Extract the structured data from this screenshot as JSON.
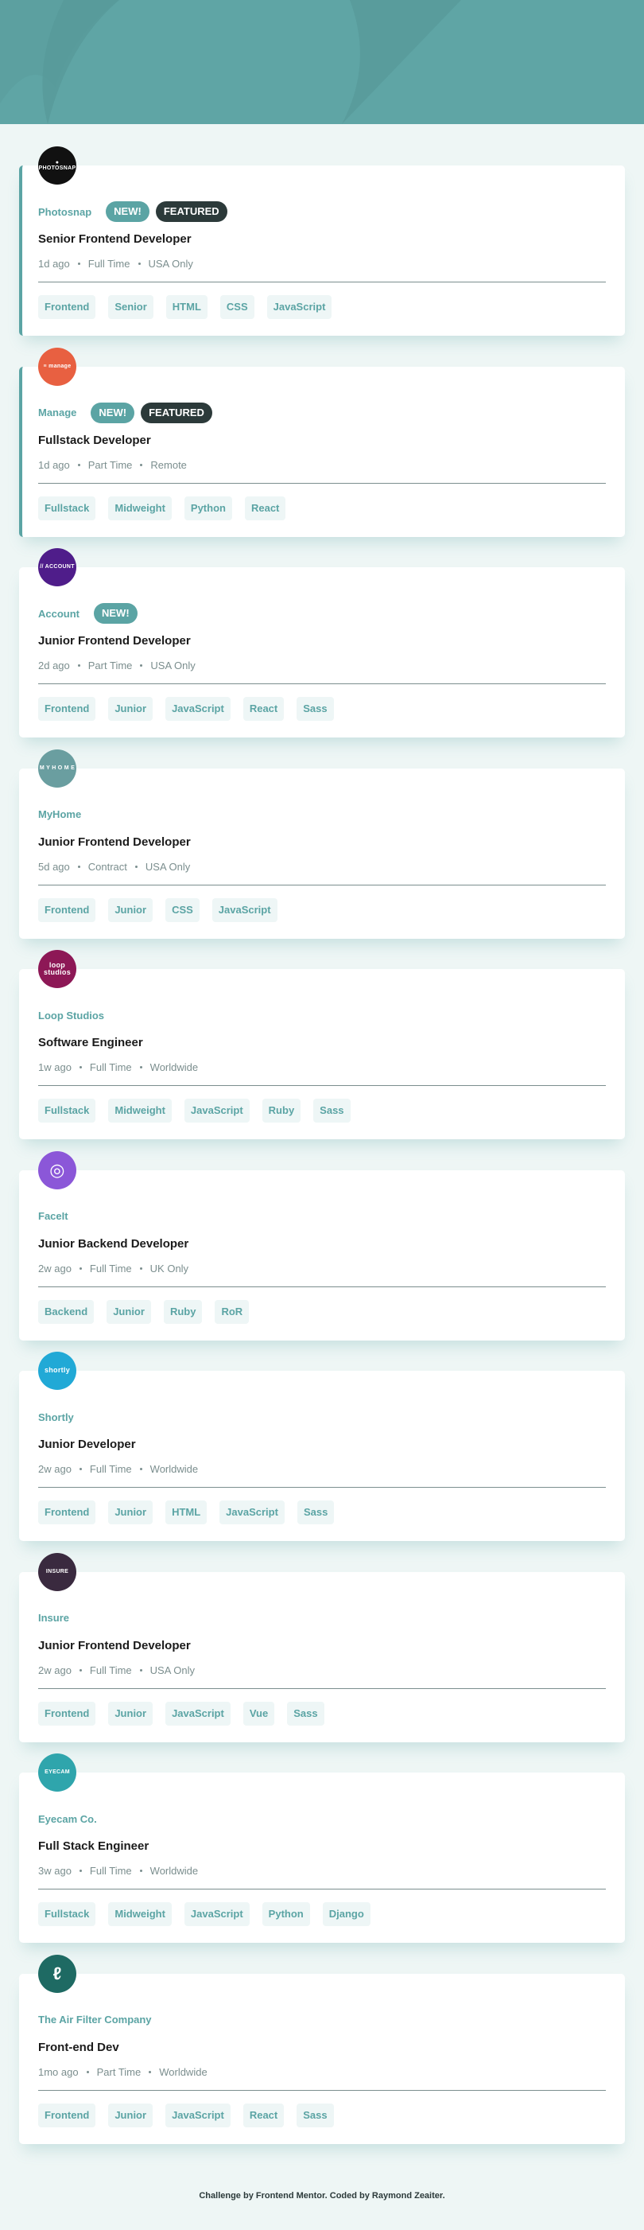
{
  "colors": {
    "accent": "#5ba4a4",
    "header_bg": "#5fa5a5",
    "page_bg": "#eef6f5",
    "dark": "#2c3a3a",
    "tag_bg": "#eef6f6",
    "muted": "#7b8e8e"
  },
  "jobs": [
    {
      "company": "Photosnap",
      "logo": {
        "text": "● PHOTOSNAP",
        "color": "#111111",
        "icon": "photosnap-logo"
      },
      "new_label": "NEW!",
      "featured_label": "FEATURED",
      "is_new": true,
      "is_featured": true,
      "position": "Senior Frontend Developer",
      "posted": "1d ago",
      "contract": "Full Time",
      "location": "USA Only",
      "tags": [
        "Frontend",
        "Senior",
        "HTML",
        "CSS",
        "JavaScript"
      ]
    },
    {
      "company": "Manage",
      "logo": {
        "text": "≡ manage",
        "color": "#e86041",
        "icon": "manage-logo"
      },
      "new_label": "NEW!",
      "featured_label": "FEATURED",
      "is_new": true,
      "is_featured": true,
      "position": "Fullstack Developer",
      "posted": "1d ago",
      "contract": "Part Time",
      "location": "Remote",
      "tags": [
        "Fullstack",
        "Midweight",
        "Python",
        "React"
      ]
    },
    {
      "company": "Account",
      "logo": {
        "text": "// ACCOUNT",
        "color": "#4f1d8a",
        "icon": "account-logo"
      },
      "new_label": "NEW!",
      "featured_label": "",
      "is_new": true,
      "is_featured": false,
      "position": "Junior Frontend Developer",
      "posted": "2d ago",
      "contract": "Part Time",
      "location": "USA Only",
      "tags": [
        "Frontend",
        "Junior",
        "JavaScript",
        "React",
        "Sass"
      ]
    },
    {
      "company": "MyHome",
      "logo": {
        "text": "M Y H O M E",
        "color": "#6a9ea0",
        "icon": "myhome-logo"
      },
      "new_label": "",
      "featured_label": "",
      "is_new": false,
      "is_featured": false,
      "position": "Junior Frontend Developer",
      "posted": "5d ago",
      "contract": "Contract",
      "location": "USA Only",
      "tags": [
        "Frontend",
        "Junior",
        "CSS",
        "JavaScript"
      ]
    },
    {
      "company": "Loop Studios",
      "logo": {
        "text": "loop studios",
        "color": "#8d1856",
        "icon": "loop-studios-logo"
      },
      "new_label": "",
      "featured_label": "",
      "is_new": false,
      "is_featured": false,
      "position": "Software Engineer",
      "posted": "1w ago",
      "contract": "Full Time",
      "location": "Worldwide",
      "tags": [
        "Fullstack",
        "Midweight",
        "JavaScript",
        "Ruby",
        "Sass"
      ]
    },
    {
      "company": "FaceIt",
      "logo": {
        "text": "◎",
        "color": "#8b57d8",
        "icon": "faceit-logo"
      },
      "new_label": "",
      "featured_label": "",
      "is_new": false,
      "is_featured": false,
      "position": "Junior Backend Developer",
      "posted": "2w ago",
      "contract": "Full Time",
      "location": "UK Only",
      "tags": [
        "Backend",
        "Junior",
        "Ruby",
        "RoR"
      ]
    },
    {
      "company": "Shortly",
      "logo": {
        "text": "shortly",
        "color": "#21a9d6",
        "icon": "shortly-logo"
      },
      "new_label": "",
      "featured_label": "",
      "is_new": false,
      "is_featured": false,
      "position": "Junior Developer",
      "posted": "2w ago",
      "contract": "Full Time",
      "location": "Worldwide",
      "tags": [
        "Frontend",
        "Junior",
        "HTML",
        "JavaScript",
        "Sass"
      ]
    },
    {
      "company": "Insure",
      "logo": {
        "text": "INSURE",
        "color": "#3a2a3f",
        "icon": "insure-logo"
      },
      "new_label": "",
      "featured_label": "",
      "is_new": false,
      "is_featured": false,
      "position": "Junior Frontend Developer",
      "posted": "2w ago",
      "contract": "Full Time",
      "location": "USA Only",
      "tags": [
        "Frontend",
        "Junior",
        "JavaScript",
        "Vue",
        "Sass"
      ]
    },
    {
      "company": "Eyecam Co.",
      "logo": {
        "text": "EYECAM",
        "color": "#2fa5ac",
        "icon": "eyecam-logo"
      },
      "new_label": "",
      "featured_label": "",
      "is_new": false,
      "is_featured": false,
      "position": "Full Stack Engineer",
      "posted": "3w ago",
      "contract": "Full Time",
      "location": "Worldwide",
      "tags": [
        "Fullstack",
        "Midweight",
        "JavaScript",
        "Python",
        "Django"
      ]
    },
    {
      "company": "The Air Filter Company",
      "logo": {
        "text": "ℓ",
        "color": "#1e6a63",
        "icon": "air-filter-logo"
      },
      "new_label": "",
      "featured_label": "",
      "is_new": false,
      "is_featured": false,
      "position": "Front-end Dev",
      "posted": "1mo ago",
      "contract": "Part Time",
      "location": "Worldwide",
      "tags": [
        "Frontend",
        "Junior",
        "JavaScript",
        "React",
        "Sass"
      ]
    }
  ],
  "footer": {
    "text": "Challenge by Frontend Mentor. Coded by Raymond Zeaiter."
  }
}
